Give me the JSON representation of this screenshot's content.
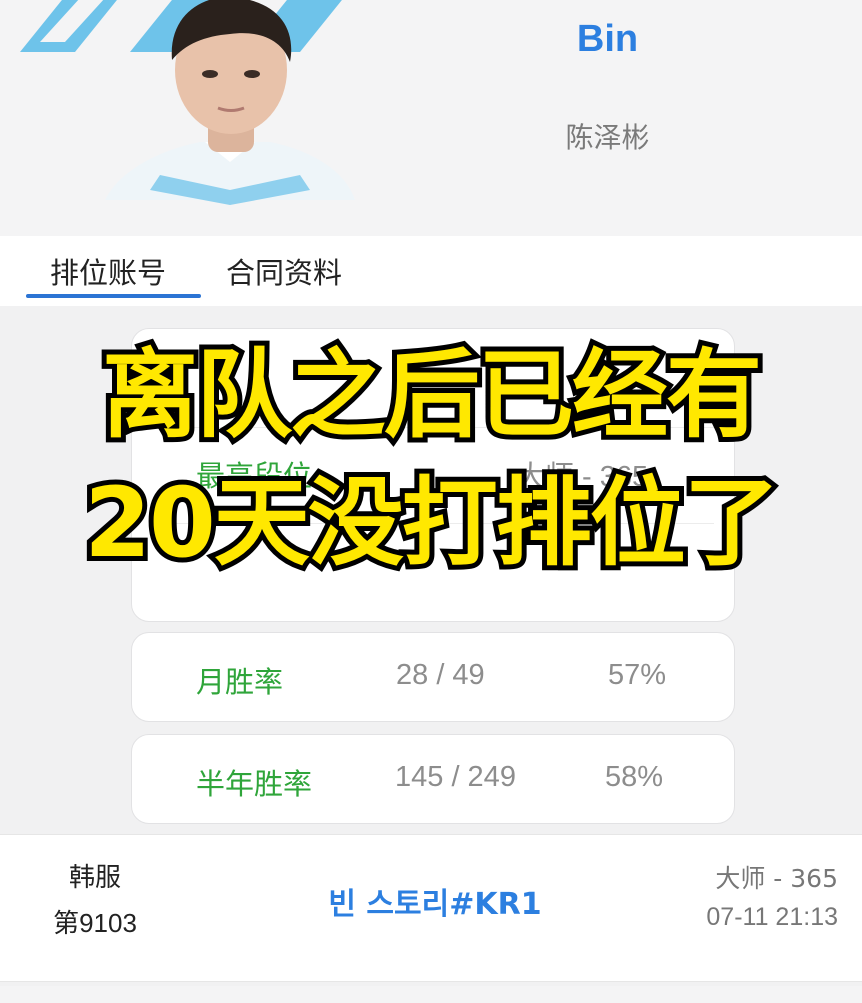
{
  "header": {
    "player_name_en": "Bin",
    "player_name_cn": "陈泽彬",
    "logo_color": "#6ec3ea"
  },
  "tabs": [
    {
      "label": "排位账号",
      "active": true
    },
    {
      "label": "合同资料",
      "active": false
    }
  ],
  "stats": {
    "top_card": {
      "rows": [
        {
          "label": "最高段位",
          "value": "大师 - 365"
        }
      ]
    },
    "monthly": {
      "label": "月胜率",
      "record": "28 / 49",
      "rate": "57%"
    },
    "half_year": {
      "label": "半年胜率",
      "record": "145 / 249",
      "rate": "58%"
    }
  },
  "account": {
    "server": "韩服",
    "server_rank": "第9103",
    "name": "빈 스토리#KR1",
    "tier": "大师 - 365",
    "time": "07-11 21:13"
  },
  "overlay": {
    "line1": "离队之后已经有",
    "line2": "20天没打排位了"
  },
  "colors": {
    "accent_blue": "#2c7fe0",
    "stat_green": "#2fa53a",
    "overlay_yellow": "#ffe800"
  }
}
